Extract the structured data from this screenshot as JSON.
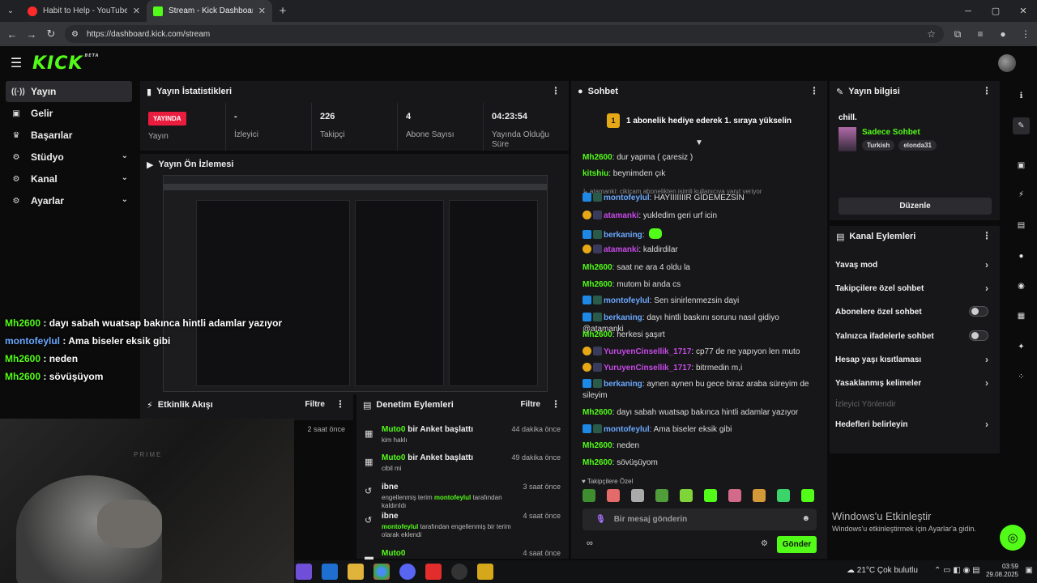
{
  "browser": {
    "tabs": [
      {
        "title": "Habit to Help - YouTube M..."
      },
      {
        "title": "Stream - Kick Dashboard"
      }
    ],
    "url": "https://dashboard.kick.com/stream",
    "icons": {
      "back": "←",
      "forward": "→",
      "reload": "↻",
      "close": "✕",
      "newtab": "+",
      "star": "☆",
      "minimize": "─",
      "maximize": "▢",
      "winclose": "✕"
    }
  },
  "header": {
    "logo": "KICK",
    "beta": "BETA"
  },
  "sidebar": {
    "items": [
      {
        "label": "Yayın",
        "icon": "((·))"
      },
      {
        "label": "Gelir",
        "icon": "▣"
      },
      {
        "label": "Başarılar",
        "icon": "♛"
      },
      {
        "label": "Stüdyo",
        "icon": "⚙"
      },
      {
        "label": "Kanal",
        "icon": "⚙"
      },
      {
        "label": "Ayarlar",
        "icon": "⚙"
      }
    ],
    "chevron": "⌄"
  },
  "stats": {
    "title": "Yayın İstatistikleri",
    "cells": [
      {
        "value": "YAYINDA",
        "label": "Yayın"
      },
      {
        "value": "-",
        "label": "İzleyici"
      },
      {
        "value": "226",
        "label": "Takipçi"
      },
      {
        "value": "4",
        "label": "Abone Sayısı"
      },
      {
        "value": "04:23:54",
        "label": "Yayında Olduğu Süre"
      }
    ]
  },
  "preview": {
    "title": "Yayın Ön İzlemesi"
  },
  "overlay": [
    {
      "user": "Mh2600",
      "text": " : dayı sabah wuatsap bakınca hintli adamlar yazıyor"
    },
    {
      "user": "montofeylul",
      "text": " : Ama biseler eksik gibi"
    },
    {
      "user": "Mh2600",
      "text": " : neden"
    },
    {
      "user": "Mh2600",
      "text": " : sövüşüyom"
    }
  ],
  "cam": {
    "brand": "PRIME"
  },
  "events": {
    "title": "Etkinlik Akışı",
    "filter": "Filtre",
    "time": "2 saat önce"
  },
  "mod": {
    "title": "Denetim Eylemleri",
    "filter": "Filtre",
    "items": [
      {
        "icon": "▦",
        "user": "Muto0",
        "action": " bir Anket başlattı",
        "sub": "kim haklı",
        "time": "44 dakika önce"
      },
      {
        "icon": "▦",
        "user": "Muto0",
        "action": " bir Anket başlattı",
        "sub": "cibil mi",
        "time": "49 dakika önce"
      },
      {
        "icon": "↺",
        "user": "",
        "action": "ibne",
        "sub1": "engellenmiş terim ",
        "sub_user": "montofeylul",
        "sub2": " tarafından kaldırıldı",
        "time": "3 saat önce"
      },
      {
        "icon": "↺",
        "user": "",
        "action": "ibne",
        "sub_user": "montofeylul",
        "sub2": " tarafından engellenmiş bir terim olarak eklendi",
        "time": "4 saat önce"
      },
      {
        "icon": "▬",
        "user": "Muto0",
        "action": "",
        "time": "4 saat önce"
      }
    ]
  },
  "chat": {
    "title": "Sohbet",
    "pinned": "1 abonelik hediye ederek 1. sıraya yükselin",
    "pinned_coin": "1",
    "reply": "↳ atamanki: cikicam abonelikten isimli kullanıcıya yanıt veriyor",
    "messages": [
      {
        "user": "Mh2600",
        "text": ": dur yapma ( çaresiz )",
        "color": "g"
      },
      {
        "user": "kitshiu",
        "text": ": beynimden çık",
        "color": "g"
      },
      {
        "user": "montofeylul",
        "text": ": HAYIIIIIIIR GİDEMEZSİN",
        "color": "b"
      },
      {
        "user": "atamanki",
        "text": ": yukledim geri urf icin",
        "color": "pk"
      },
      {
        "user": "berkaning",
        "text": ": ",
        "color": "b"
      },
      {
        "user": "atamanki",
        "text": ": kaldirdilar",
        "color": "pk"
      },
      {
        "user": "Mh2600",
        "text": ": saat ne ara 4 oldu la",
        "color": "g"
      },
      {
        "user": "Mh2600",
        "text": ": mutom bi anda cs",
        "color": "g"
      },
      {
        "user": "montofeylul",
        "text": ": Sen sinirlenmezsin dayi",
        "color": "b"
      },
      {
        "user": "berkaning",
        "text": ": dayı hintli baskını sorunu nasıl gidiyo @atamanki",
        "color": "b"
      },
      {
        "user": "Mh2600",
        "text": ": herkesi şaşırt",
        "color": "g"
      },
      {
        "user": "YuruyenCinsellik_1717",
        "text": ": cp77 de ne yapıyon len muto",
        "color": "r"
      },
      {
        "user": "YuruyenCinsellik_1717",
        "text": ": bitrmedin m,i",
        "color": "r"
      },
      {
        "user": "berkaning",
        "text": ": aynen aynen bu gece biraz araba süreyim de sileyim",
        "color": "b"
      },
      {
        "user": "Mh2600",
        "text": ": dayı sabah wuatsap bakınca hintli adamlar yazıyor",
        "color": "g"
      },
      {
        "user": "montofeylul",
        "text": ": Ama biseler eksik gibi",
        "color": "b"
      },
      {
        "user": "Mh2600",
        "text": ": neden",
        "color": "g"
      },
      {
        "user": "Mh2600",
        "text": ": sövüşüyom",
        "color": "g"
      }
    ],
    "sub_label": "♥ Takipçilere Özel",
    "input_placeholder": "Bir mesaj gönderin",
    "send": "Gönder"
  },
  "info": {
    "title": "Yayın bilgisi",
    "stream_title": "chill.",
    "category": "Sadece Sohbet",
    "tags": [
      "Turkish",
      "elonda31"
    ],
    "edit": "Düzenle"
  },
  "actions": {
    "title": "Kanal Eylemleri",
    "items": [
      {
        "label": "Yavaş mod",
        "kind": "arrow"
      },
      {
        "label": "Takipçilere özel sohbet",
        "kind": "arrow"
      },
      {
        "label": "Abonelere özel sohbet",
        "kind": "toggle"
      },
      {
        "label": "Yalnızca ifadelerle sohbet",
        "kind": "toggle"
      },
      {
        "label": "Hesap yaşı kısıtlaması",
        "kind": "arrow"
      },
      {
        "label": "Yasaklanmış kelimeler",
        "kind": "arrow"
      },
      {
        "label": "İzleyici Yönlendir",
        "kind": "dim"
      },
      {
        "label": "Hedefleri belirleyin",
        "kind": "arrow"
      }
    ]
  },
  "windows": {
    "activate": "Windows'u Etkinleştir",
    "activate_sub": "Windows'u etkinleştirmek için Ayarlar'a gidin."
  },
  "taskbar": {
    "weather": "21°C  Çok bulutlu",
    "time": "03:59",
    "date": "29.08.2025"
  },
  "colors": {
    "accent": "#53fc18",
    "live": "#eb1d3e",
    "panel": "#171719"
  }
}
